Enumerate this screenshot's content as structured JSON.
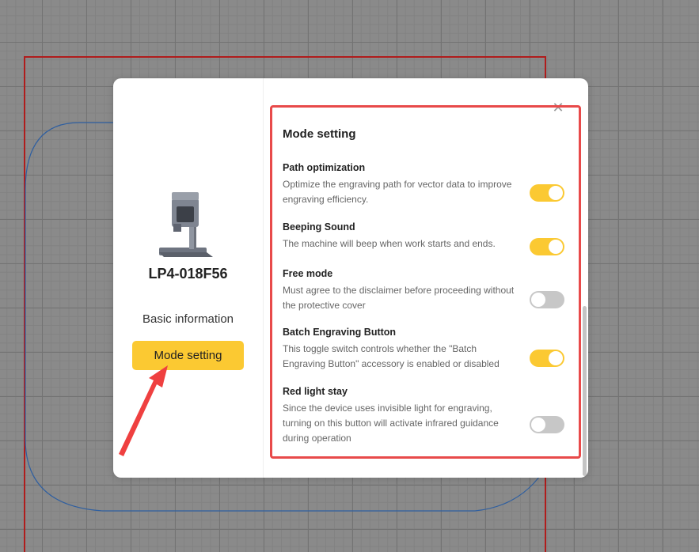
{
  "sidebar": {
    "device_name": "LP4-018F56",
    "nav_basic": "Basic information",
    "nav_mode": "Mode setting"
  },
  "panel": {
    "title": "Mode setting",
    "close_icon": "close-icon",
    "settings": [
      {
        "title": "Path optimization",
        "desc": "Optimize the engraving path for vector data to improve engraving efficiency.",
        "enabled": true
      },
      {
        "title": "Beeping Sound",
        "desc": "The machine will beep when work starts and ends.",
        "enabled": true
      },
      {
        "title": "Free mode",
        "desc": "Must agree to the disclaimer before proceeding without the protective cover",
        "enabled": false
      },
      {
        "title": "Batch Engraving Button",
        "desc": "This toggle switch controls whether the \"Batch Engraving Button\" accessory is enabled or disabled",
        "enabled": true
      },
      {
        "title": "Red light stay",
        "desc": "Since the device uses invisible light for engraving, turning on this button will activate infrared guidance during operation",
        "enabled": false
      }
    ]
  },
  "colors": {
    "accent": "#fbc932",
    "toggle_off": "#c7c7c7",
    "highlight": "#e84a4a",
    "canvas_border": "#b01c1c",
    "canvas_path": "#2f5fa0"
  }
}
